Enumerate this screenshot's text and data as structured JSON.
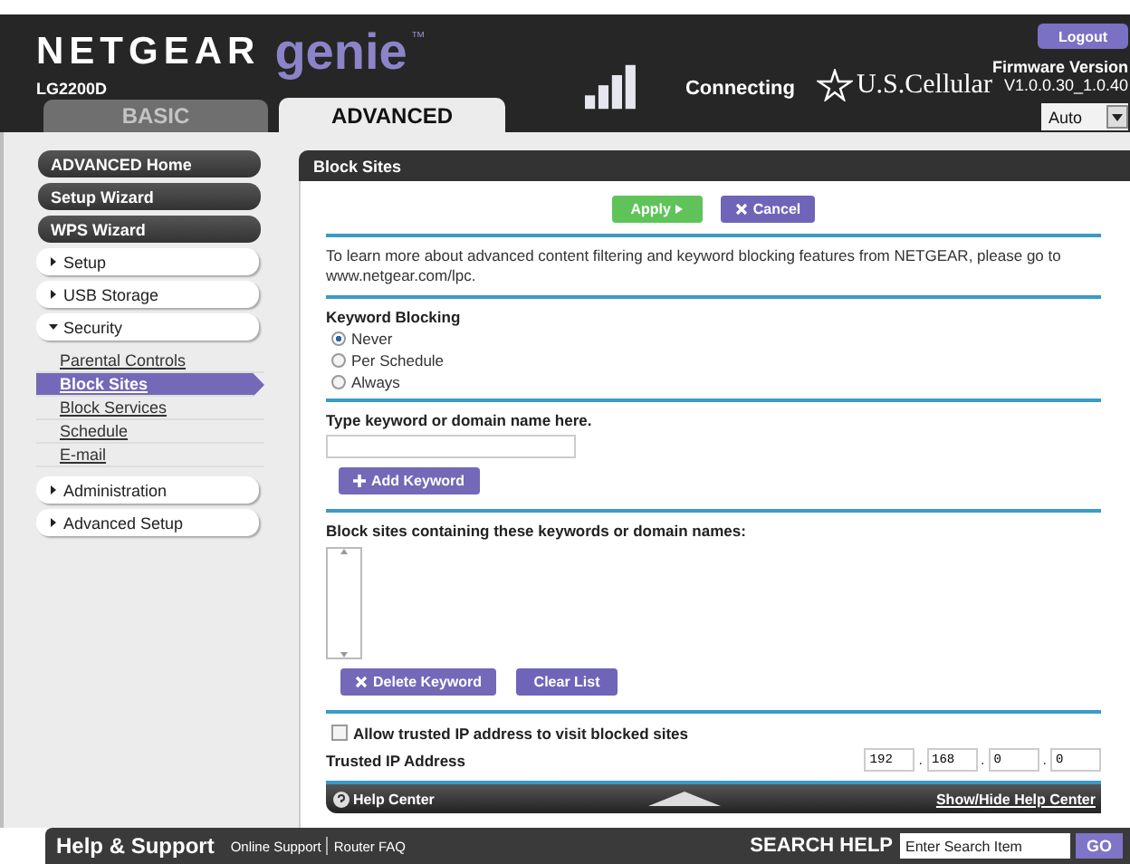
{
  "header": {
    "brand": "NETGEAR",
    "product": "genie",
    "trademark": "™",
    "model": "LG2200D",
    "status": "Connecting",
    "carrier": "U.S.Cellular",
    "logout": "Logout",
    "firmware_label": "Firmware Version",
    "firmware": "V1.0.0.30_1.0.40",
    "language": "Auto"
  },
  "tabs": [
    {
      "label": "BASIC",
      "selected": false
    },
    {
      "label": "ADVANCED",
      "selected": true
    }
  ],
  "sidebar": [
    {
      "kind": "main",
      "label": "ADVANCED Home"
    },
    {
      "kind": "main",
      "label": "Setup Wizard"
    },
    {
      "kind": "main",
      "label": "WPS Wizard"
    },
    {
      "kind": "section",
      "label": "Setup",
      "expanded": false
    },
    {
      "kind": "section",
      "label": "USB Storage",
      "expanded": false
    },
    {
      "kind": "section",
      "label": "Security",
      "expanded": true,
      "children": [
        {
          "label": "Parental Controls",
          "selected": false
        },
        {
          "label": "Block Sites",
          "selected": true
        },
        {
          "label": "Block Services",
          "selected": false
        },
        {
          "label": "Schedule",
          "selected": false
        },
        {
          "label": "E-mail",
          "selected": false
        }
      ]
    },
    {
      "kind": "section",
      "label": "Administration",
      "expanded": false
    },
    {
      "kind": "section",
      "label": "Advanced Setup",
      "expanded": false
    }
  ],
  "panel": {
    "title": "Block Sites",
    "apply": "Apply",
    "cancel": "Cancel",
    "intro": "To learn more about advanced content filtering and keyword blocking features from NETGEAR, please go to www.netgear.com/lpc.",
    "keyword_blocking_label": "Keyword Blocking",
    "options": [
      {
        "label": "Never",
        "selected": true
      },
      {
        "label": "Per Schedule",
        "selected": false
      },
      {
        "label": "Always",
        "selected": false
      }
    ],
    "keyword_label": "Type keyword or domain name here.",
    "add_keyword": "Add Keyword",
    "list_label": "Block sites containing these keywords or domain names:",
    "delete_keyword": "Delete Keyword",
    "clear_list": "Clear List",
    "allow_trusted": {
      "label": "Allow trusted IP address to visit blocked sites",
      "checked": false
    },
    "trusted_ip_label": "Trusted IP Address",
    "trusted_ip": [
      "192",
      "168",
      "0",
      "0"
    ],
    "ip_separator": ".",
    "help_center": "Help Center",
    "show_hide": "Show/Hide Help Center"
  },
  "footer": {
    "title": "Help & Support",
    "links": [
      "Online Support",
      "Router FAQ"
    ],
    "search_label": "SEARCH HELP",
    "search_placeholder": "Enter Search Item",
    "go": "GO"
  }
}
